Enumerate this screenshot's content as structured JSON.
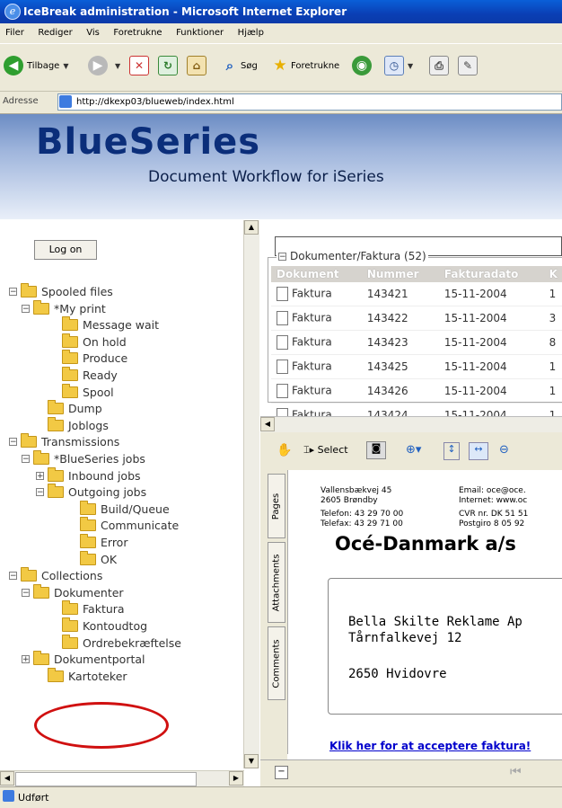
{
  "window": {
    "title": "IceBreak administration - Microsoft Internet Explorer"
  },
  "menu": [
    "Filer",
    "Rediger",
    "Vis",
    "Foretrukne",
    "Funktioner",
    "Hjælp"
  ],
  "toolbar": {
    "back": "Tilbage",
    "search": "Søg",
    "favorites": "Foretrukne"
  },
  "address": {
    "label": "Adresse",
    "url": "http://dkexp03/blueweb/index.html"
  },
  "banner": {
    "brand": "BlueSeries",
    "tagline": "Document Workflow for iSeries"
  },
  "logon": "Log on",
  "tree": [
    {
      "label": "Spooled files",
      "level": 0,
      "pm": "−"
    },
    {
      "label": "*My print",
      "level": 1,
      "pm": "−"
    },
    {
      "label": "Message wait",
      "level": 3
    },
    {
      "label": "On hold",
      "level": 3
    },
    {
      "label": "Produce",
      "level": 3
    },
    {
      "label": "Ready",
      "level": 3
    },
    {
      "label": "Spool",
      "level": 3
    },
    {
      "label": "Dump",
      "level": 2
    },
    {
      "label": "Joblogs",
      "level": 2
    },
    {
      "label": "Transmissions",
      "level": 0,
      "pm": "−"
    },
    {
      "label": "*BlueSeries jobs",
      "level": 1,
      "pm": "−"
    },
    {
      "label": "Inbound jobs",
      "level": 2,
      "pm": "+"
    },
    {
      "label": "Outgoing jobs",
      "level": 2,
      "pm": "−"
    },
    {
      "label": "Build/Queue",
      "level": 4
    },
    {
      "label": "Communicate",
      "level": 4
    },
    {
      "label": "Error",
      "level": 4
    },
    {
      "label": "OK",
      "level": 4
    },
    {
      "label": "Collections",
      "level": 0,
      "pm": "−"
    },
    {
      "label": "Dokumenter",
      "level": 1,
      "pm": "−"
    },
    {
      "label": "Faktura",
      "level": 3
    },
    {
      "label": "Kontoudtog",
      "level": 3
    },
    {
      "label": "Ordrebekræftelse",
      "level": 3
    },
    {
      "label": "Dokumentportal",
      "level": 1,
      "pm": "+"
    },
    {
      "label": "Kartoteker",
      "level": 2
    }
  ],
  "grid": {
    "legend": "Dokumenter/Faktura (52)",
    "columns": [
      "Dokument",
      "Nummer",
      "Fakturadato",
      "K"
    ],
    "rows": [
      [
        "Faktura",
        "143421",
        "15-11-2004",
        "1"
      ],
      [
        "Faktura",
        "143422",
        "15-11-2004",
        "3"
      ],
      [
        "Faktura",
        "143423",
        "15-11-2004",
        "8"
      ],
      [
        "Faktura",
        "143425",
        "15-11-2004",
        "1"
      ],
      [
        "Faktura",
        "143426",
        "15-11-2004",
        "1"
      ],
      [
        "Faktura",
        "143424",
        "15-11-2004",
        "1"
      ]
    ]
  },
  "viewer": {
    "select": "Select",
    "tabs": [
      "Pages",
      "Attachments",
      "Comments"
    ],
    "header_left": [
      "Vallensbækvej 45",
      "2605 Brøndby",
      "Telefon: 43 29 70 00",
      "Telefax: 43 29 71 00"
    ],
    "header_right": [
      "Email: oce@oce.",
      "Internet: www.oc",
      "CVR nr. DK 51 51",
      "Postgiro 8 05 92"
    ],
    "company": "Océ-Danmark a/s",
    "recipient": [
      "Bella Skilte Reklame Ap",
      "Tårnfalkevej 12",
      "2650 Hvidovre"
    ],
    "accept_link": "Klik her for at acceptere faktura!"
  },
  "status": "Udført"
}
